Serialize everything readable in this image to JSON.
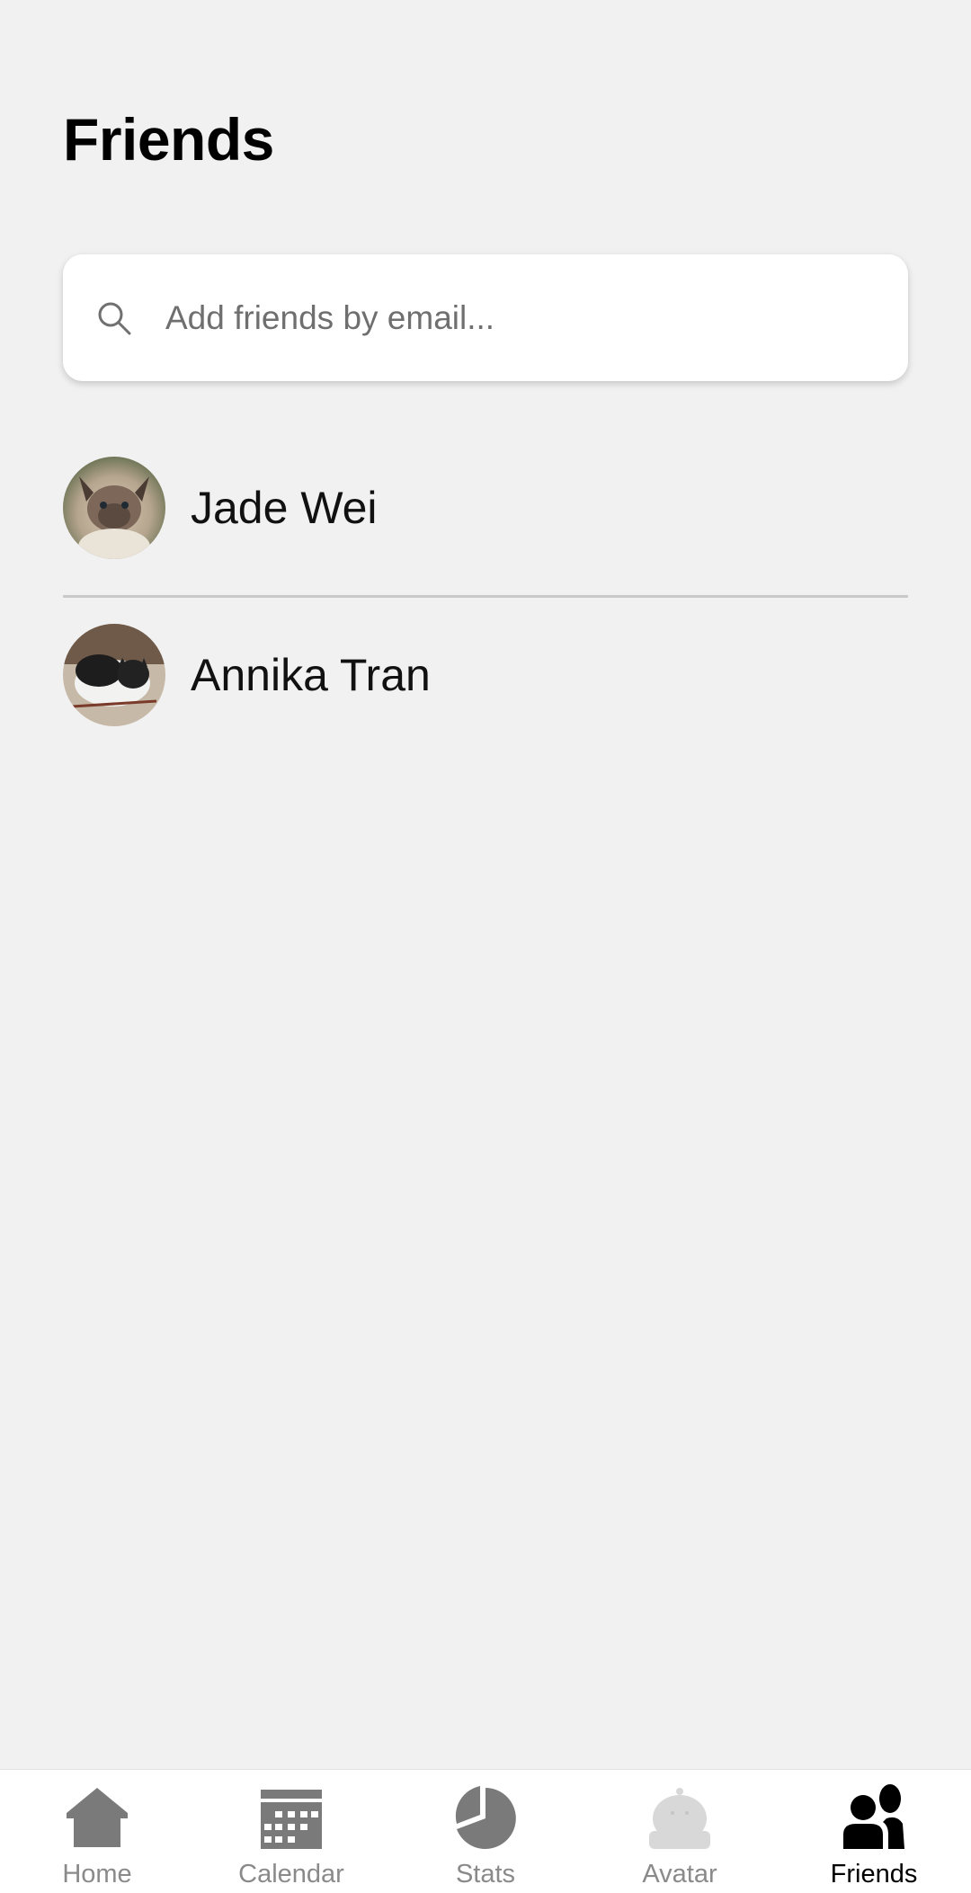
{
  "header": {
    "title": "Friends"
  },
  "search": {
    "placeholder": "Add friends by email..."
  },
  "friends": [
    {
      "name": "Jade Wei",
      "avatar_icon": "cat-photo-siamese"
    },
    {
      "name": "Annika Tran",
      "avatar_icon": "cat-photo-black-white"
    }
  ],
  "tabs": [
    {
      "label": "Home",
      "icon": "home-icon",
      "active": false
    },
    {
      "label": "Calendar",
      "icon": "calendar-icon",
      "active": false
    },
    {
      "label": "Stats",
      "icon": "pie-chart-icon",
      "active": false
    },
    {
      "label": "Avatar",
      "icon": "avatar-icon",
      "active": false
    },
    {
      "label": "Friends",
      "icon": "friends-icon",
      "active": true
    }
  ],
  "colors": {
    "background": "#f1f1f1",
    "tab_inactive": "#7a7a7a",
    "tab_active": "#000000",
    "avatar_tab_icon": "#d8d8d8"
  }
}
